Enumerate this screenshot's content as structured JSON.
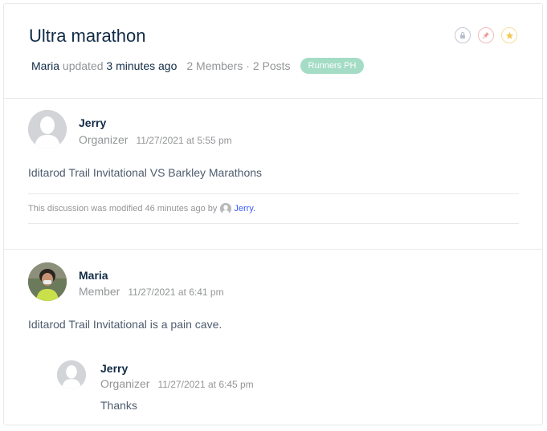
{
  "discussion": {
    "title": "Ultra marathon",
    "updated_by": "Maria",
    "updated_word": "updated",
    "updated_ago": "3 minutes ago",
    "members_posts": "2 Members · 2 Posts",
    "group_badge": "Runners PH",
    "actions": [
      {
        "icon": "lock-icon",
        "color": "#c3c9d6"
      },
      {
        "icon": "pin-icon",
        "color": "#f2b9b9"
      },
      {
        "icon": "star-icon",
        "color": "#f6df9a"
      }
    ]
  },
  "posts": [
    {
      "author": "Jerry",
      "role": "Organizer",
      "time": "11/27/2021 at 5:55 pm",
      "content": "Iditarod Trail Invitational VS Barkley Marathons",
      "modified_text": "This discussion was modified 46 minutes ago by",
      "modified_by": "Jerry."
    },
    {
      "author": "Maria",
      "role": "Member",
      "time": "11/27/2021 at 6:41 pm",
      "content": "Iditarod Trail Invitational is a pain cave."
    }
  ],
  "reply": {
    "author": "Jerry",
    "role": "Organizer",
    "time": "11/27/2021 at 6:45 pm",
    "content": "Thanks"
  }
}
